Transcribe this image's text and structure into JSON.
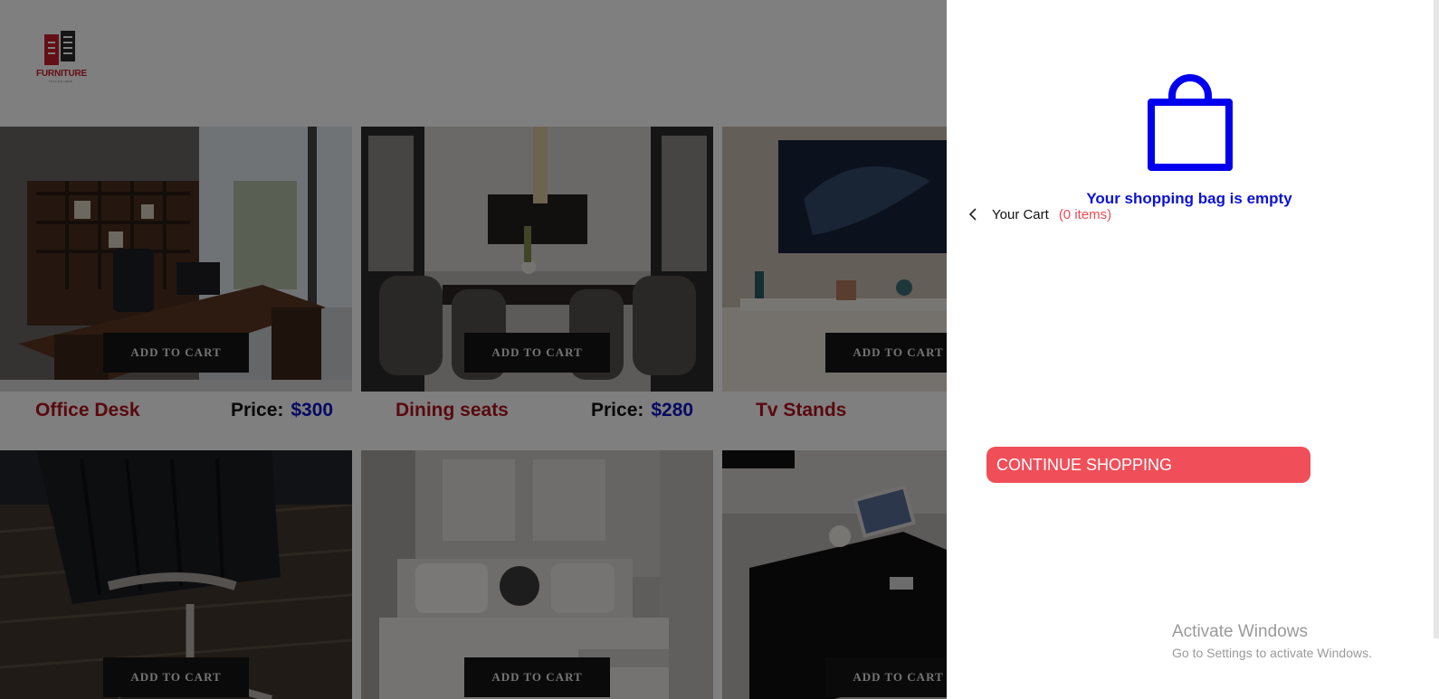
{
  "brand": {
    "logo_word": "FURNITURE",
    "logo_tagline": "TAGLINE HERE"
  },
  "products": [
    {
      "name": "Office Desk",
      "price_label": "Price:",
      "price": "$300",
      "cart_label": "ADD TO CART"
    },
    {
      "name": "Dining seats",
      "price_label": "Price:",
      "price": "$280",
      "cart_label": "ADD TO CART"
    },
    {
      "name": "Tv Stands",
      "price_label": "",
      "price": "",
      "cart_label": "ADD TO CART"
    },
    {
      "name": "",
      "cart_label": "ADD TO CART"
    },
    {
      "name": "",
      "cart_label": "ADD TO CART"
    },
    {
      "name": "",
      "cart_label": "ADD TO CART"
    }
  ],
  "cart": {
    "title": "Your Cart",
    "count": "(0 items)",
    "empty_message": "Your shopping bag is empty",
    "continue_label": "CONTINUE SHOPPING"
  },
  "watermark": {
    "line1": "Activate Windows",
    "line2": "Go to Settings to activate Windows."
  },
  "colors": {
    "accent": "#f04f59",
    "empty_text": "#0b12d6",
    "product_name": "#b3131d",
    "price": "#0b12c4",
    "bag_icon": "#0000ee"
  },
  "icons": {
    "bag": "shopping-bag-icon",
    "back": "chevron-left-icon"
  }
}
